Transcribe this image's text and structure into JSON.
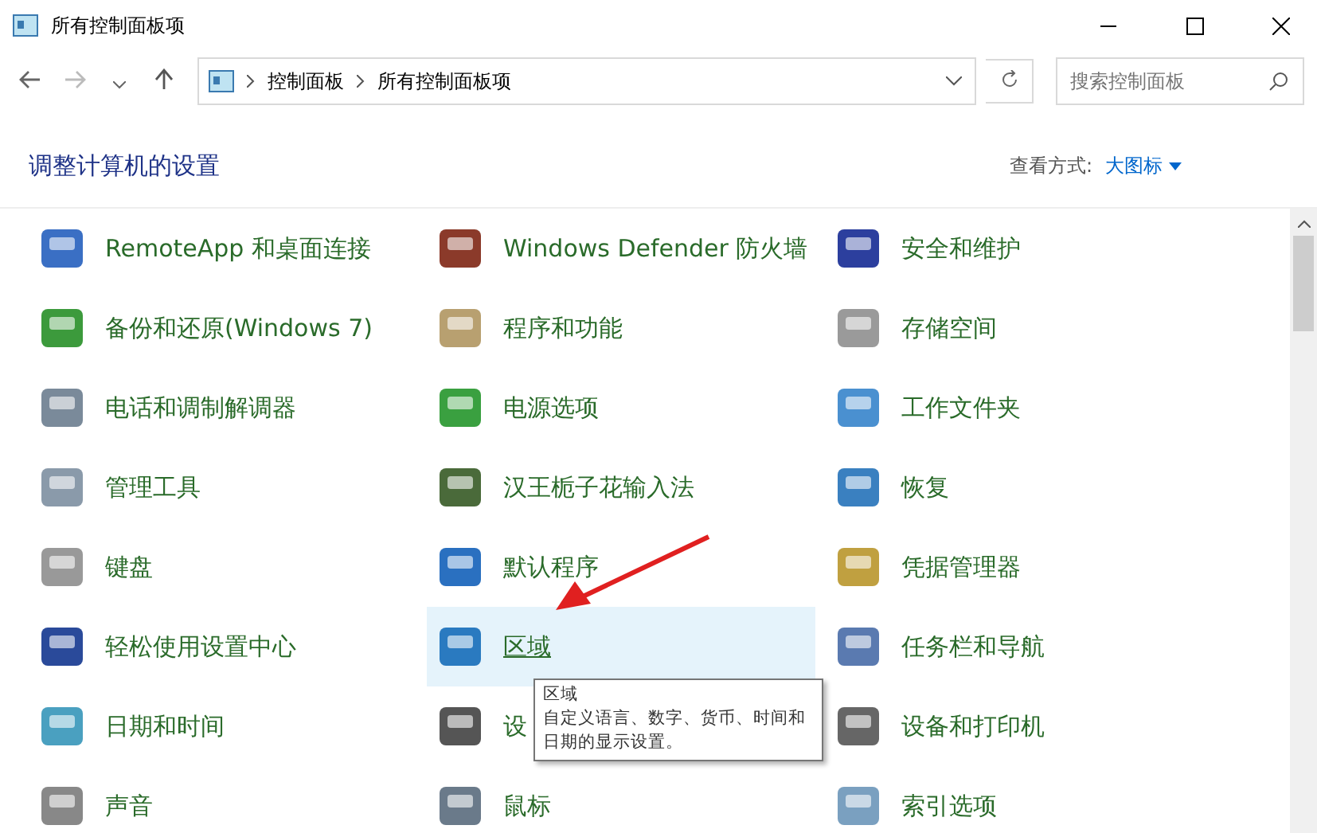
{
  "window": {
    "title": "所有控制面板项"
  },
  "address": {
    "crumbs": [
      "控制面板",
      "所有控制面板项"
    ]
  },
  "search": {
    "placeholder": "搜索控制面板"
  },
  "heading": "调整计算机的设置",
  "view": {
    "label": "查看方式:",
    "value": "大图标"
  },
  "items": [
    {
      "label": "RemoteApp 和桌面连接",
      "selected": false
    },
    {
      "label": "Windows Defender 防火墙",
      "selected": false
    },
    {
      "label": "安全和维护",
      "selected": false
    },
    {
      "label": "备份和还原(Windows 7)",
      "selected": false
    },
    {
      "label": "程序和功能",
      "selected": false
    },
    {
      "label": "存储空间",
      "selected": false
    },
    {
      "label": "电话和调制解调器",
      "selected": false
    },
    {
      "label": "电源选项",
      "selected": false
    },
    {
      "label": "工作文件夹",
      "selected": false
    },
    {
      "label": "管理工具",
      "selected": false
    },
    {
      "label": "汉王栀子花输入法",
      "selected": false
    },
    {
      "label": "恢复",
      "selected": false
    },
    {
      "label": "键盘",
      "selected": false
    },
    {
      "label": "默认程序",
      "selected": false
    },
    {
      "label": "凭据管理器",
      "selected": false
    },
    {
      "label": "轻松使用设置中心",
      "selected": false
    },
    {
      "label": "区域",
      "selected": true
    },
    {
      "label": "任务栏和导航",
      "selected": false
    },
    {
      "label": "日期和时间",
      "selected": false
    },
    {
      "label": "设",
      "selected": false
    },
    {
      "label": "设备和打印机",
      "selected": false
    },
    {
      "label": "声音",
      "selected": false
    },
    {
      "label": "鼠标",
      "selected": false
    },
    {
      "label": "索引选项",
      "selected": false
    }
  ],
  "tooltip": {
    "title": "区域",
    "text": "自定义语言、数字、货币、时间和日期的显示设置。"
  }
}
